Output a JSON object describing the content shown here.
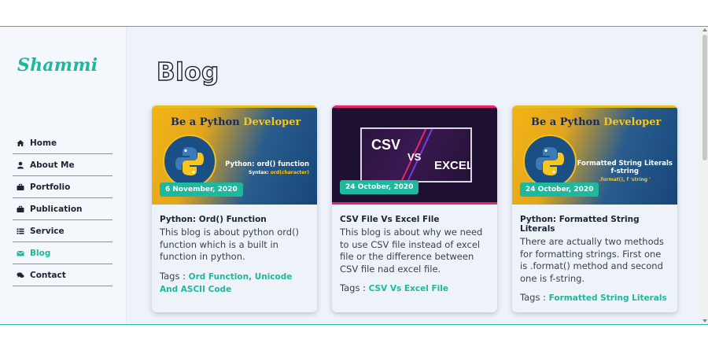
{
  "brand": {
    "name": "Shammi"
  },
  "sidebar": {
    "items": [
      {
        "label": "Home",
        "icon": "home-icon"
      },
      {
        "label": "About Me",
        "icon": "user-icon"
      },
      {
        "label": "Portfolio",
        "icon": "briefcase-icon"
      },
      {
        "label": "Publication",
        "icon": "briefcase-icon"
      },
      {
        "label": "Service",
        "icon": "list-icon"
      },
      {
        "label": "Blog",
        "icon": "envelope-icon",
        "active": true
      },
      {
        "label": "Contact",
        "icon": "comments-icon"
      }
    ]
  },
  "main": {
    "title": "Blog",
    "cards": [
      {
        "thumb": {
          "headline_a": "Be a Python ",
          "headline_b": "Developer",
          "subtitle": "Python: ord() function",
          "syntax_label": "Syntax: ",
          "syntax_value": "ord(character)"
        },
        "date": "6 November, 2020",
        "title": "Python: Ord() Function",
        "description": "This blog is about python ord() function which is a built in function in python.",
        "tags_label": "Tags : ",
        "tags": "Ord Function, Unicode And ASCII Code"
      },
      {
        "thumb": {
          "csv": "CSV",
          "vs": "VS",
          "excel": "EXCEL"
        },
        "date": "24 October, 2020",
        "title": "CSV File Vs Excel File",
        "description": "This blog is about why we need to use CSV file instead of excel file or the difference between CSV file nad excel file.",
        "tags_label": "Tags : ",
        "tags": "CSV Vs Excel File"
      },
      {
        "thumb": {
          "headline_a": "Be a Python ",
          "headline_b": "Developer",
          "subtitle_1": "Formatted String Literals",
          "subtitle_2": "f-string",
          "syntax_value": ".format(), f 'string '"
        },
        "date": "24 October, 2020",
        "title": "Python: Formatted String Literals",
        "description": "There are actually two methods for formatting strings. First one is .format() method and second one is f-string.",
        "tags_label": "Tags : ",
        "tags": "Formatted String Literals"
      }
    ]
  },
  "colors": {
    "accent": "#1fb89c",
    "dark": "#1d2433",
    "bg": "#eef2f9"
  }
}
